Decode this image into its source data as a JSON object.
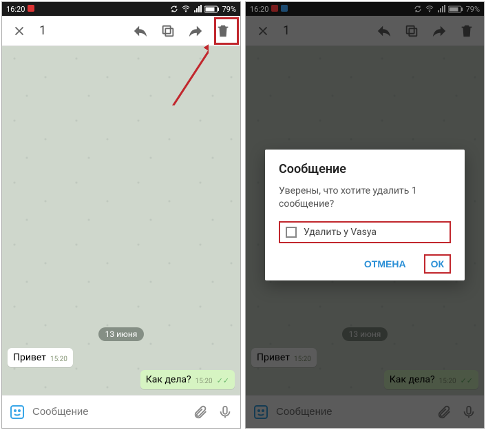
{
  "status": {
    "time": "16:20",
    "battery": "79%"
  },
  "header": {
    "selected_count": "1"
  },
  "chat": {
    "date_label": "13 июня",
    "messages": [
      {
        "text": "Привет",
        "time": "15:20",
        "dir": "in"
      },
      {
        "text": "Как дела?",
        "time": "15:20",
        "dir": "out"
      }
    ]
  },
  "input": {
    "placeholder": "Сообщение"
  },
  "dialog": {
    "title": "Сообщение",
    "body": "Уверены, что хотите удалить 1 сообщение?",
    "checkbox_label": "Удалить у Vasya",
    "cancel": "ОТМЕНА",
    "ok": "ОК"
  }
}
